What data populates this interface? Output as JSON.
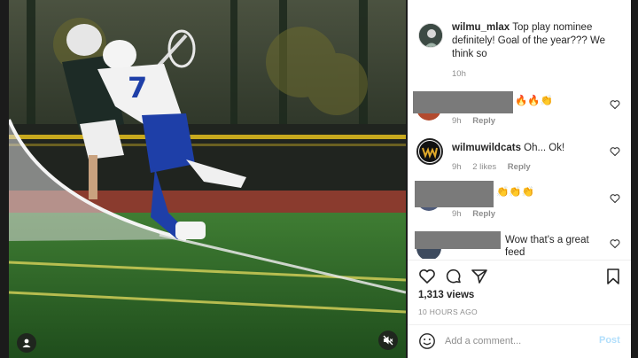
{
  "post": {
    "caption": {
      "username": "wilmu_mlax",
      "text": "Top play nominee definitely! Goal of the year??? We think so",
      "time": "10h"
    },
    "comments": [
      {
        "username": "",
        "text": "🔥🔥👏",
        "time": "9h",
        "likes": "",
        "reply_label": "Reply",
        "redacted": true
      },
      {
        "username": "wilmuwildcats",
        "text": "Oh... Ok!",
        "time": "9h",
        "likes": "2 likes",
        "reply_label": "Reply",
        "redacted": false
      },
      {
        "username": "",
        "text": "👏👏👏",
        "time": "9h",
        "likes": "",
        "reply_label": "Reply",
        "redacted": true
      },
      {
        "username": "",
        "text": "Wow that's a great feed",
        "time": "",
        "likes": "",
        "reply_label": "",
        "redacted": true
      }
    ],
    "views": "1,313 views",
    "posted_ago": "10 HOURS AGO",
    "add_comment": {
      "placeholder": "Add a comment...",
      "post_label": "Post"
    }
  },
  "video": {
    "player_number": "7"
  },
  "colors": {
    "turf": "#2f6b2a",
    "jersey_white": "#f2f2f2",
    "jersey_blue": "#1e3fa8",
    "post_button": "#b2dffc",
    "meta_gray": "#8e8e8e"
  },
  "icons": [
    "user-tag-icon",
    "mute-icon",
    "heart-icon",
    "comment-icon",
    "share-icon",
    "save-icon",
    "emoji-icon"
  ]
}
